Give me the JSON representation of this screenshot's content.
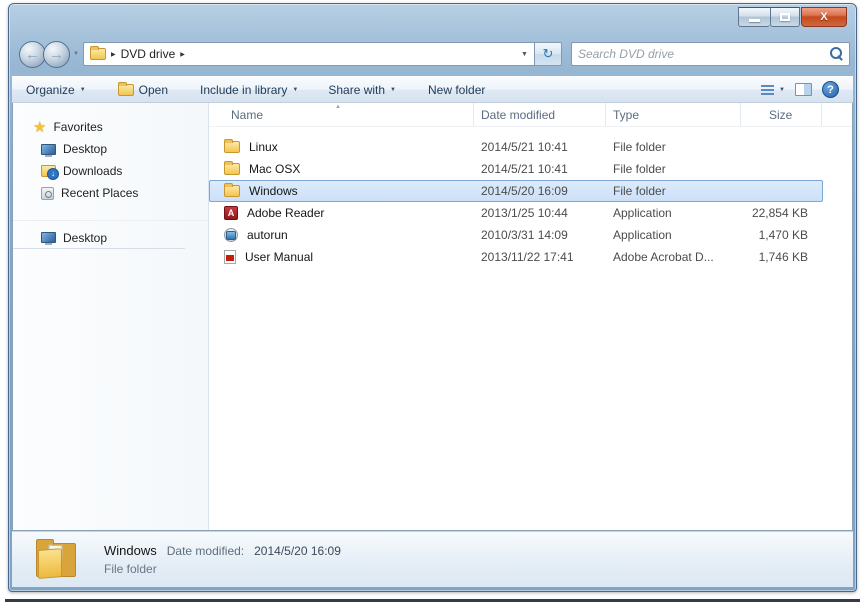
{
  "address_bar": {
    "path_root_icon": "folder-icon",
    "segment": "DVD drive"
  },
  "search": {
    "placeholder": "Search DVD drive"
  },
  "toolbar": {
    "organize": "Organize",
    "open": "Open",
    "include_in_library": "Include in library",
    "share_with": "Share with",
    "new_folder": "New folder"
  },
  "sidebar": {
    "favorites": {
      "label": "Favorites",
      "items": [
        {
          "label": "Desktop"
        },
        {
          "label": "Downloads"
        },
        {
          "label": "Recent Places"
        }
      ]
    },
    "tree": {
      "items": [
        {
          "label": "Desktop"
        }
      ]
    }
  },
  "file_list": {
    "columns": {
      "name": "Name",
      "date_modified": "Date modified",
      "type": "Type",
      "size": "Size"
    },
    "rows": [
      {
        "name": "Linux",
        "date": "2014/5/21 10:41",
        "type": "File folder",
        "size": "",
        "icon": "folder",
        "selected": false
      },
      {
        "name": "Mac OSX",
        "date": "2014/5/21 10:41",
        "type": "File folder",
        "size": "",
        "icon": "folder",
        "selected": false
      },
      {
        "name": "Windows",
        "date": "2014/5/20 16:09",
        "type": "File folder",
        "size": "",
        "icon": "folder",
        "selected": true
      },
      {
        "name": "Adobe Reader",
        "date": "2013/1/25 10:44",
        "type": "Application",
        "size": "22,854 KB",
        "icon": "adobe-reader",
        "selected": false
      },
      {
        "name": "autorun",
        "date": "2010/3/31 14:09",
        "type": "Application",
        "size": "1,470 KB",
        "icon": "application",
        "selected": false
      },
      {
        "name": "User Manual",
        "date": "2013/11/22 17:41",
        "type": "Adobe Acrobat D...",
        "size": "1,746 KB",
        "icon": "pdf-document",
        "selected": false
      }
    ]
  },
  "details_pane": {
    "name": "Windows",
    "date_label": "Date modified:",
    "date": "2014/5/20 16:09",
    "type": "File folder"
  },
  "colors": {
    "frame_blue": "#86abcc",
    "selection_fill": "#cbe0f8",
    "selection_border": "#7da7d9",
    "close_button": "#c4491f",
    "folder_gold": "#f2c64f"
  }
}
